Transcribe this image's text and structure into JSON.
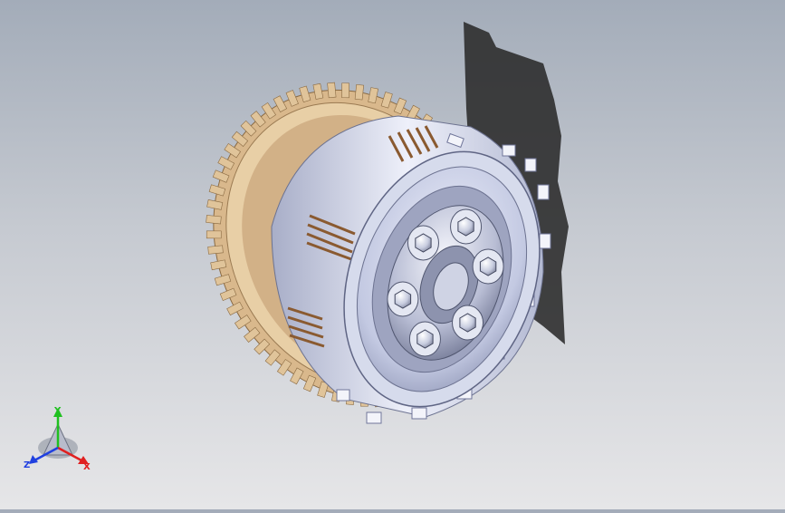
{
  "viewport": {
    "background_top": "#a3acb9",
    "background_bottom": "#e6e6e8"
  },
  "model": {
    "part": "clutch-assembly",
    "gear_color": "#e0c49a",
    "housing_color": "#c9cfe6",
    "hub_color": "#b9bfd6",
    "friction_color": "#c98f5c",
    "bolt_count": 6
  },
  "triad": {
    "x_label": "X",
    "y_label": "Y",
    "z_label": "Z",
    "x_color": "#e02020",
    "y_color": "#20c020",
    "z_color": "#2040e0"
  }
}
